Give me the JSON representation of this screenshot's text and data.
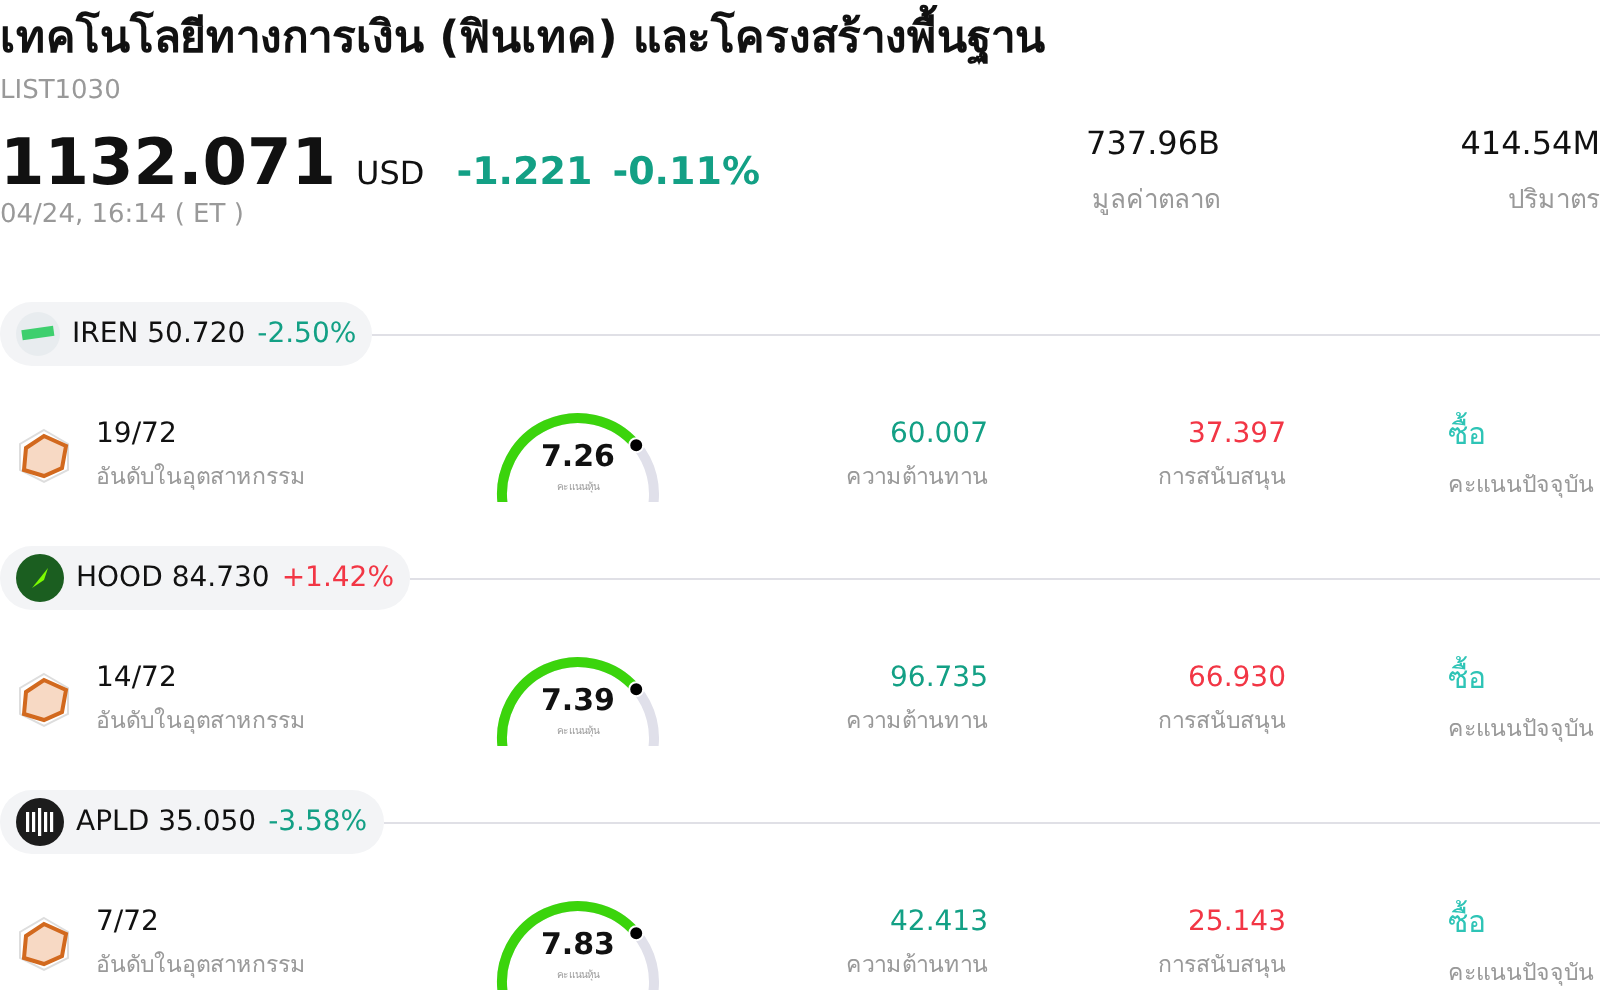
{
  "header": {
    "title": "เทคโนโลยีทางการเงิน (ฟินเทค) และโครงสร้างพื้นฐาน",
    "code": "LIST1030",
    "price": "1132.071",
    "currency": "USD",
    "change": "-1.221",
    "change_pct": "-0.11%",
    "color": "#13a085",
    "time": "04/24, 16:14  ( ET )"
  },
  "stats": [
    {
      "value": "737.96B",
      "label": "มูลค่าตลาด"
    },
    {
      "value": "414.54M",
      "label": "ปริมาตร"
    }
  ],
  "stocks": [
    {
      "symbol": "IREN",
      "price": "50.720",
      "change": "-2.50%",
      "color": "#13a085",
      "kind": "bars",
      "rank": "19/72",
      "rank_label": "อันดับในอุตสาหกรรม",
      "score": "7.26",
      "score_label": "คะแนนหุ้น",
      "resistance": "60.007",
      "resistance_label": "ความต้านทาน",
      "support": "37.397",
      "support_label": "การสนับสนุน",
      "rating": "ซื้อ",
      "rating_label": "คะแนนปัจจุบัน"
    },
    {
      "symbol": "HOOD",
      "price": "84.730",
      "change": "+1.42%",
      "color": "#f23645",
      "kind": "feather",
      "rank": "14/72",
      "rank_label": "อันดับในอุตสาหกรรม",
      "score": "7.39",
      "score_label": "คะแนนหุ้น",
      "resistance": "96.735",
      "resistance_label": "ความต้านทาน",
      "support": "66.930",
      "support_label": "การสนับสนุน",
      "rating": "ซื้อ",
      "rating_label": "คะแนนปัจจุบัน"
    },
    {
      "symbol": "APLD",
      "price": "35.050",
      "change": "-3.58%",
      "color": "#13a085",
      "kind": "ring",
      "rank": "7/72",
      "rank_label": "อันดับในอุตสาหกรรม",
      "score": "7.83",
      "score_label": "คะแนนหุ้น",
      "resistance": "42.413",
      "resistance_label": "ความต้านทาน",
      "support": "25.143",
      "support_label": "การสนับสนุน",
      "rating": "ซื้อ",
      "rating_label": "คะแนนปัจจุบัน"
    }
  ]
}
